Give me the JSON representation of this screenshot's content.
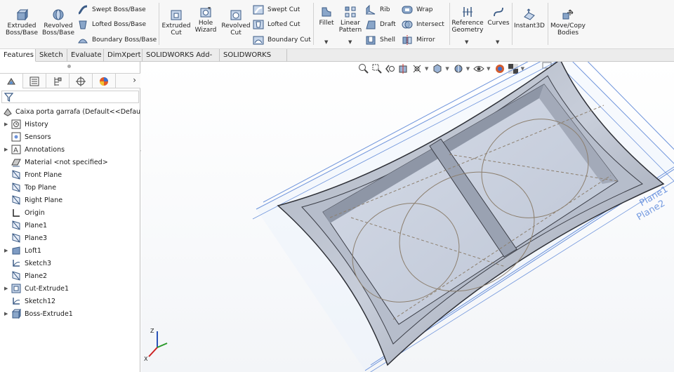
{
  "ribbon": {
    "extruded_boss": "Extruded\nBoss/Base",
    "revolved_boss": "Revolved\nBoss/Base",
    "swept_boss": "Swept Boss/Base",
    "lofted_boss": "Lofted Boss/Base",
    "boundary_boss": "Boundary Boss/Base",
    "extruded_cut": "Extruded\nCut",
    "hole_wizard": "Hole\nWizard",
    "revolved_cut": "Revolved\nCut",
    "swept_cut": "Swept Cut",
    "lofted_cut": "Lofted Cut",
    "boundary_cut": "Boundary Cut",
    "fillet": "Fillet",
    "linear_pattern": "Linear\nPattern",
    "rib": "Rib",
    "draft": "Draft",
    "shell": "Shell",
    "wrap": "Wrap",
    "intersect": "Intersect",
    "mirror": "Mirror",
    "reference_geometry": "Reference\nGeometry",
    "curves": "Curves",
    "instant3d": "Instant3D",
    "move_copy_bodies": "Move/Copy\nBodies"
  },
  "tabs": [
    {
      "label": "Features",
      "active": true
    },
    {
      "label": "Sketch"
    },
    {
      "label": "Evaluate"
    },
    {
      "label": "DimXpert"
    },
    {
      "label": "SOLIDWORKS Add-Ins"
    },
    {
      "label": "SOLIDWORKS MBD"
    }
  ],
  "panel_tabs": [
    "feature-manager-icon",
    "property-manager-icon",
    "configuration-manager-icon",
    "dimxpert-manager-icon",
    "display-manager-icon"
  ],
  "part": {
    "name": "Caixa porta garrafa  (Default<<Default>_"
  },
  "tree": [
    {
      "label": "History",
      "icon": "history-icon",
      "expandable": true
    },
    {
      "label": "Sensors",
      "icon": "sensors-icon",
      "expandable": false
    },
    {
      "label": "Annotations",
      "icon": "annotations-icon",
      "expandable": true
    },
    {
      "label": "Material <not specified>",
      "icon": "material-icon",
      "expandable": false
    },
    {
      "label": "Front Plane",
      "icon": "plane-icon",
      "expandable": false
    },
    {
      "label": "Top Plane",
      "icon": "plane-icon",
      "expandable": false
    },
    {
      "label": "Right Plane",
      "icon": "plane-icon",
      "expandable": false
    },
    {
      "label": "Origin",
      "icon": "origin-icon",
      "expandable": false
    },
    {
      "label": "Plane1",
      "icon": "plane-icon",
      "expandable": false
    },
    {
      "label": "Plane3",
      "icon": "plane-icon",
      "expandable": false
    },
    {
      "label": "Loft1",
      "icon": "loft-icon",
      "expandable": true
    },
    {
      "label": "Sketch3",
      "icon": "sketch-icon",
      "expandable": false
    },
    {
      "label": "Plane2",
      "icon": "plane-icon",
      "expandable": false
    },
    {
      "label": "Cut-Extrude1",
      "icon": "cut-extrude-icon",
      "expandable": true
    },
    {
      "label": "Sketch12",
      "icon": "sketch-icon",
      "expandable": false
    },
    {
      "label": "Boss-Extrude1",
      "icon": "boss-extrude-icon",
      "expandable": true
    }
  ],
  "viewport": {
    "plane_labels": [
      "Plane1",
      "Plane2"
    ],
    "triad": {
      "z": "Z",
      "x": "X"
    }
  },
  "colors": {
    "accent": "#4a7cd9",
    "model_face": "#c3cad9",
    "model_edge": "#2d2f36",
    "sketch_line": "#8c7f6e"
  }
}
